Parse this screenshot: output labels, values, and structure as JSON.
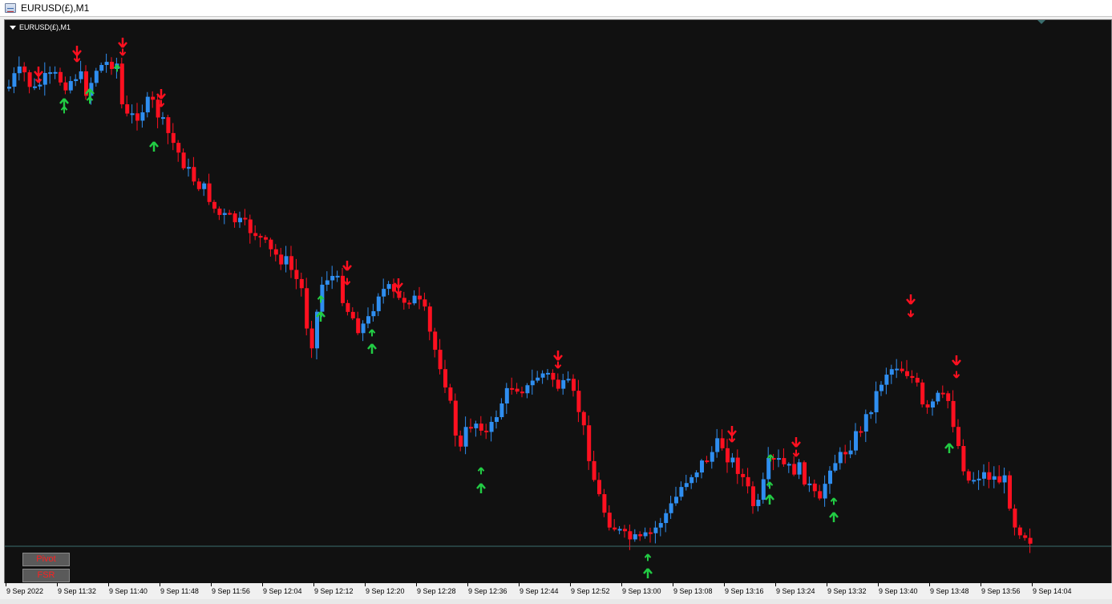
{
  "window": {
    "title": "EURUSD(£),M1",
    "icon": "chart-window-icon"
  },
  "chart": {
    "label": "EURUSD(£),M1",
    "colors": {
      "bull": "#2f8ef0",
      "bear": "#ff1020",
      "background": "#111111",
      "arrow_up": "#22cc44",
      "arrow_down": "#ff1020",
      "price_line": "#3a6e6e"
    }
  },
  "buttons": {
    "pivot": "Pivot",
    "fsr": "FSR"
  },
  "time_axis": [
    "9 Sep 2022",
    "9 Sep 11:32",
    "9 Sep 11:40",
    "9 Sep 11:48",
    "9 Sep 11:56",
    "9 Sep 12:04",
    "9 Sep 12:12",
    "9 Sep 12:20",
    "9 Sep 12:28",
    "9 Sep 12:36",
    "9 Sep 12:44",
    "9 Sep 12:52",
    "9 Sep 13:00",
    "9 Sep 13:08",
    "9 Sep 13:16",
    "9 Sep 13:24",
    "9 Sep 13:32",
    "9 Sep 13:40",
    "9 Sep 13:48",
    "9 Sep 13:56",
    "9 Sep 14:04"
  ]
}
